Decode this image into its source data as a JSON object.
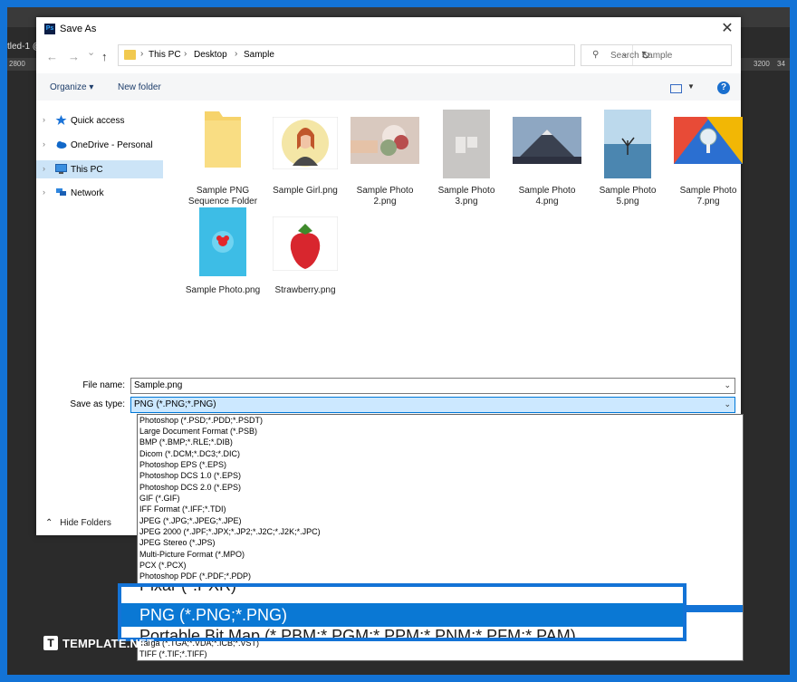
{
  "app": {
    "title": "Save As",
    "icon_text": "Ps",
    "tab_fragment": "tled-1 @"
  },
  "ruler": {
    "left": "2800",
    "r1": "3200",
    "r2": "34"
  },
  "nav": {
    "back": "←",
    "forward": "→",
    "down": "⌄",
    "up": "↑"
  },
  "address": {
    "crumbs": [
      "This PC",
      "Desktop",
      "Sample"
    ],
    "sep": "›",
    "refresh": "↻"
  },
  "search": {
    "placeholder": "Search Sample",
    "icon": "⚲"
  },
  "toolbar": {
    "organize": "Organize ▾",
    "new_folder": "New folder",
    "help": "?"
  },
  "sidebar": {
    "items": [
      {
        "label": "Quick access",
        "icon": "star-icon"
      },
      {
        "label": "OneDrive - Personal",
        "icon": "cloud-icon"
      },
      {
        "label": "This PC",
        "icon": "computer-icon",
        "selected": true
      },
      {
        "label": "Network",
        "icon": "network-icon"
      }
    ]
  },
  "files": [
    {
      "name": "Sample PNG Sequence Folder"
    },
    {
      "name": "Sample Girl.png"
    },
    {
      "name": "Sample Photo 2.png"
    },
    {
      "name": "Sample Photo 3.png"
    },
    {
      "name": "Sample Photo 4.png"
    },
    {
      "name": "Sample Photo 5.png"
    },
    {
      "name": "Sample Photo 7.png"
    },
    {
      "name": "Sample Photo.png"
    },
    {
      "name": "Strawberry.png"
    }
  ],
  "form": {
    "file_name_label": "File name:",
    "file_name_value": "Sample.png",
    "type_label": "Save as type:",
    "type_value": "PNG (*.PNG;*.PNG)",
    "hide_folders": "Hide Folders"
  },
  "dropdown": {
    "options": [
      "Photoshop (*.PSD;*.PDD;*.PSDT)",
      "Large Document Format (*.PSB)",
      "BMP (*.BMP;*.RLE;*.DIB)",
      "Dicom (*.DCM;*.DC3;*.DIC)",
      "Photoshop EPS (*.EPS)",
      "Photoshop DCS 1.0 (*.EPS)",
      "Photoshop DCS 2.0 (*.EPS)",
      "GIF (*.GIF)",
      "IFF Format (*.IFF;*.TDI)",
      "JPEG (*.JPG;*.JPEG;*.JPE)",
      "JPEG 2000 (*.JPF;*.JPX;*.JP2;*.J2C;*.J2K;*.JPC)",
      "JPEG Stereo (*.JPS)",
      "Multi-Picture Format (*.MPO)",
      "PCX (*.PCX)",
      "Photoshop PDF (*.PDF;*.PDP)",
      "Targa (*.TGA;*.VDA;*.ICB;*.VST)",
      "TIFF (*.TIF;*.TIFF)"
    ]
  },
  "zoom": {
    "above": "Pixar (*.PXR)",
    "selected": "PNG (*.PNG;*.PNG)",
    "below": "Portable Bit Map (*.PBM;*.PGM;*.PPM;*.PNM;*.PFM;*.PAM)"
  },
  "watermark": {
    "logo": "T",
    "text": "TEMPLATE.NET"
  },
  "colors": {
    "accent": "#1373d6",
    "selection": "#0a78d4",
    "sidebar_selected": "#cce4f7",
    "type_bg": "#cce8ff"
  }
}
